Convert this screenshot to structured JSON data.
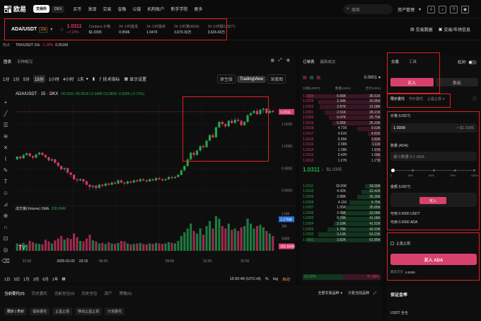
{
  "nav": {
    "logo": "欧易",
    "pill_exchange": "交易所",
    "pill_dex": "DEX",
    "items": [
      "买币",
      "发现",
      "交易",
      "金融",
      "公链",
      "机构账户",
      "新手学院",
      "更多"
    ],
    "search_placeholder": "搜索",
    "asset_mgmt": "资产管理"
  },
  "ticker": {
    "pair": "ADA/USDT",
    "leverage": "10x",
    "price": "1.0311",
    "change": "+7.24%",
    "stats": [
      {
        "label": "Cardano 价格",
        "value": "$1.0305"
      },
      {
        "label": "24 小时最低",
        "value": "0.9596"
      },
      {
        "label": "24 小时最高",
        "value": "1.0470"
      },
      {
        "label": "24 小时量(ADA)",
        "value": "3,670.33万"
      },
      {
        "label": "24 小时额(USDT)",
        "value": "3,626.43万"
      }
    ],
    "right_links": [
      "交易数据",
      "交易/市场信息"
    ]
  },
  "subticker": {
    "label": "热点",
    "pair": "TRX/USDT 10x",
    "change": "-1.28%",
    "price": "0.26160"
  },
  "chart": {
    "tabs": [
      "图表",
      "币种概况"
    ],
    "intervals": [
      "1分",
      "1分",
      "5分",
      "15分",
      "1小时",
      "4小时",
      "1天"
    ],
    "active_interval": "15分",
    "indicator_label": "技术指标",
    "display_label": "显示设置",
    "modes": [
      "原生版",
      "TradingView",
      "深度图"
    ],
    "active_mode": "TradingView",
    "legend_pair": "ADA/USDT · 15 · OKX",
    "legend_values": "O0.9911 H0.9818 L0.9408 C0.9838 -0.0059 (-0.72%)",
    "price_tag": "1.0311",
    "price_levels": [
      "1.0200",
      "1.0000",
      "0.9800",
      "0.9600"
    ],
    "volume_label": "成交量(Volume) SMA",
    "volume_value": "228.654K",
    "volume_levels": [
      "1.5M",
      "1M",
      "500K"
    ],
    "volume_tag": "1.276M",
    "volume_tag2": "181.654K",
    "time_labels": [
      "21:00",
      "2025-01-02",
      "23:15",
      "06:00",
      "09:00",
      "12:00",
      "15:00"
    ],
    "ranges": [
      "1日",
      "5日",
      "1月",
      "3月",
      "6月",
      "1年"
    ],
    "footer_time": "15:50:49 (UTC+8)",
    "footer_pct": "%",
    "footer_log": "log",
    "footer_auto": "自动"
  },
  "chart_data": {
    "type": "candlestick",
    "candles": [
      [
        0.988,
        0.9905,
        0.987,
        0.991
      ],
      [
        0.9905,
        0.989,
        0.988,
        0.9915
      ],
      [
        0.989,
        0.992,
        0.9885,
        0.993
      ],
      [
        0.992,
        0.9935,
        0.991,
        0.9945
      ],
      [
        0.9935,
        0.991,
        0.99,
        0.994
      ],
      [
        0.991,
        0.9895,
        0.988,
        0.9915
      ],
      [
        0.9895,
        0.9925,
        0.989,
        0.993
      ],
      [
        0.9925,
        0.994,
        0.9915,
        0.995
      ],
      [
        0.994,
        0.992,
        0.991,
        0.9945
      ],
      [
        0.992,
        0.99,
        0.989,
        0.9925
      ],
      [
        0.99,
        0.987,
        0.986,
        0.9905
      ],
      [
        0.987,
        0.988,
        0.986,
        0.989
      ],
      [
        0.988,
        0.985,
        0.984,
        0.9885
      ],
      [
        0.985,
        0.982,
        0.981,
        0.9855
      ],
      [
        0.982,
        0.979,
        0.978,
        0.9825
      ],
      [
        0.979,
        0.98,
        0.977,
        0.981
      ],
      [
        0.98,
        0.976,
        0.975,
        0.9805
      ],
      [
        0.976,
        0.974,
        0.972,
        0.9765
      ],
      [
        0.974,
        0.97,
        0.969,
        0.9745
      ],
      [
        0.97,
        0.969,
        0.967,
        0.971
      ],
      [
        0.969,
        0.97,
        0.968,
        0.971
      ],
      [
        0.97,
        0.968,
        0.966,
        0.9705
      ],
      [
        0.968,
        0.965,
        0.964,
        0.969
      ],
      [
        0.965,
        0.963,
        0.96,
        0.9655
      ],
      [
        0.963,
        0.964,
        0.961,
        0.965
      ],
      [
        0.964,
        0.962,
        0.96,
        0.965
      ],
      [
        0.962,
        0.965,
        0.961,
        0.966
      ],
      [
        0.965,
        0.964,
        0.9625,
        0.966
      ],
      [
        0.964,
        0.966,
        0.963,
        0.967
      ],
      [
        0.966,
        0.965,
        0.964,
        0.967
      ],
      [
        0.965,
        0.967,
        0.9645,
        0.968
      ],
      [
        0.967,
        0.966,
        0.965,
        0.968
      ],
      [
        0.966,
        0.969,
        0.9655,
        0.97
      ],
      [
        0.969,
        0.967,
        0.966,
        0.97
      ],
      [
        0.967,
        0.966,
        0.964,
        0.9675
      ],
      [
        0.966,
        0.968,
        0.965,
        0.969
      ],
      [
        0.968,
        0.967,
        0.966,
        0.969
      ],
      [
        0.967,
        0.969,
        0.9665,
        0.97
      ],
      [
        0.969,
        0.968,
        0.967,
        0.97
      ],
      [
        0.968,
        0.97,
        0.9675,
        0.971
      ],
      [
        0.97,
        0.969,
        0.968,
        0.971
      ],
      [
        0.969,
        0.968,
        0.967,
        0.97
      ],
      [
        0.968,
        0.97,
        0.9675,
        0.971
      ],
      [
        0.97,
        0.969,
        0.968,
        0.971
      ],
      [
        0.969,
        0.971,
        0.9685,
        0.972
      ],
      [
        0.971,
        0.97,
        0.969,
        0.972
      ],
      [
        0.97,
        0.969,
        0.968,
        0.971
      ],
      [
        0.969,
        0.97,
        0.9685,
        0.971
      ],
      [
        0.97,
        0.972,
        0.9695,
        0.973
      ],
      [
        0.972,
        0.971,
        0.97,
        0.973
      ],
      [
        0.971,
        0.972,
        0.9705,
        0.973
      ],
      [
        0.972,
        0.974,
        0.9715,
        0.975
      ],
      [
        0.974,
        0.978,
        0.9735,
        0.979
      ],
      [
        0.978,
        0.982,
        0.977,
        0.983
      ],
      [
        0.982,
        0.988,
        0.981,
        0.989
      ],
      [
        0.988,
        0.994,
        0.987,
        0.995
      ],
      [
        0.994,
        0.992,
        0.99,
        0.996
      ],
      [
        0.992,
        0.996,
        0.991,
        0.997
      ],
      [
        0.996,
        1.0,
        0.995,
        1.001
      ],
      [
        1.0,
        0.999,
        0.998,
        1.002
      ],
      [
        0.999,
        1.005,
        0.9985,
        1.006
      ],
      [
        1.005,
        1.01,
        1.004,
        1.011
      ],
      [
        1.01,
        1.008,
        1.007,
        1.012
      ],
      [
        1.008,
        1.017,
        1.0075,
        1.018
      ],
      [
        1.017,
        1.022,
        1.016,
        1.023
      ],
      [
        1.022,
        1.02,
        1.018,
        1.023
      ],
      [
        1.02,
        1.018,
        1.016,
        1.021
      ],
      [
        1.018,
        1.023,
        1.017,
        1.024
      ],
      [
        1.023,
        1.021,
        1.02,
        1.025
      ],
      [
        1.021,
        1.024,
        1.02,
        1.026
      ],
      [
        1.024,
        1.023,
        1.0215,
        1.026
      ],
      [
        1.023,
        1.019,
        1.018,
        1.024
      ],
      [
        1.019,
        1.022,
        1.0185,
        1.023
      ],
      [
        1.022,
        1.028,
        1.021,
        1.029
      ],
      [
        1.028,
        1.03,
        1.027,
        1.031
      ],
      [
        1.03,
        1.032,
        1.029,
        1.033
      ],
      [
        1.032,
        1.029,
        1.028,
        1.034
      ],
      [
        1.029,
        1.033,
        1.0285,
        1.034
      ],
      [
        1.033,
        1.034,
        1.03,
        1.035
      ],
      [
        1.034,
        1.03,
        1.029,
        1.0345
      ],
      [
        1.03,
        1.032,
        1.0295,
        1.034
      ],
      [
        1.032,
        1.0311,
        1.03,
        1.033
      ]
    ],
    "volumes": [
      300,
      280,
      320,
      250,
      400,
      350,
      300,
      280,
      260,
      450,
      380,
      300,
      420,
      500,
      600,
      450,
      520,
      480,
      700,
      550,
      400,
      380,
      500,
      650,
      420,
      380,
      300,
      320,
      280,
      350,
      300,
      280,
      320,
      400,
      380,
      300,
      260,
      280,
      300,
      320,
      280,
      260,
      300,
      280,
      320,
      300,
      280,
      300,
      350,
      320,
      300,
      400,
      600,
      750,
      900,
      1100,
      800,
      700,
      900,
      650,
      1000,
      1200,
      900,
      1400,
      1300,
      1000,
      900,
      1100,
      850,
      900,
      800,
      950,
      1000,
      1300,
      1100,
      900,
      1000,
      1050,
      950,
      800,
      700,
      600
    ],
    "ylim": [
      0.95,
      1.04
    ],
    "volume_ylim": [
      0,
      1600
    ]
  },
  "orderbook": {
    "tabs": [
      "订单表",
      "最新成交"
    ],
    "precision": "0.0001",
    "col_price": "价格(USDT)",
    "col_qty": "数量(ADA)",
    "col_total": "合计(ADA)",
    "asks": [
      [
        "1.0324",
        "5.66K",
        "36.51K",
        0.95
      ],
      [
        "1.0323",
        "2.34K",
        "30.85K",
        0.8
      ],
      [
        "1.0322",
        "2.87K",
        "31.08K",
        0.78
      ],
      [
        "1.0321",
        "2.51K",
        "28.21K",
        0.72
      ],
      [
        "1.0320",
        "0.47K",
        "25.70K",
        0.66
      ],
      [
        "1.0319",
        "5.55K",
        "25.23K",
        0.62
      ],
      [
        "1.0318",
        "4.71K",
        "9.53K",
        0.3
      ],
      [
        "1.0317",
        "4.61K",
        "4.82K",
        0.16
      ],
      [
        "1.0316",
        "0.05K",
        "3.82K",
        0.12
      ],
      [
        "1.0315",
        "2.58K",
        "3.11K",
        0.1
      ],
      [
        "1.0314",
        "1.28K",
        "1.97K",
        0.07
      ],
      [
        "1.0313",
        "0.42K",
        "1.69K",
        0.06
      ],
      [
        "1.0312",
        "1.27K",
        "1.27K",
        0.04
      ]
    ],
    "mid_price": "1.0311",
    "mid_arrow": "↓",
    "mid_usd": "$1.0305",
    "bids": [
      [
        "1.0311",
        "18.00K",
        "18.00K",
        0.2
      ],
      [
        "1.0310",
        "4.42K",
        "22.42K",
        0.25
      ],
      [
        "1.0309",
        "3.88K",
        "26.30K",
        0.3
      ],
      [
        "1.0308",
        "4.11K",
        "9.75K",
        0.4
      ],
      [
        "1.0307",
        "1.55K",
        "35.85K",
        0.45
      ],
      [
        "1.0306",
        "3.45K",
        "33.08K",
        0.5
      ],
      [
        "1.0305",
        "0.78K",
        "41.08K",
        0.55
      ],
      [
        "1.0304",
        "2.18K",
        "41.52K",
        0.6
      ],
      [
        "1.0303",
        "1.78K",
        "43.23K",
        0.68
      ],
      [
        "1.0302",
        "3.13K",
        "53.23K",
        0.8
      ],
      [
        "1.0301",
        "3.82K",
        "61.85K",
        0.95
      ]
    ],
    "buy_pct": "52.02%",
    "sell_pct": "47.98%",
    "buy_ratio": 0.52
  },
  "tradepanel": {
    "tabs": [
      "交易",
      "工具"
    ],
    "leverage_label": "杠杆",
    "buy_label": "买入",
    "sell_label": "卖出",
    "order_types": [
      "限价委托",
      "市价委托",
      "止盈止损"
    ],
    "price_label": "价格 (USDT)",
    "price_value": "1.0309",
    "price_usd": "≈ $1.0305",
    "qty_label": "数量 (ADA)",
    "qty_placeholder": "最小数量 0.1 ADA",
    "total_label": "金额 (USDT)",
    "available_usdt": "可用 0.0000 USDT",
    "available_ada": "可用 0.0000 ADA",
    "tpsl_label": "止盈止损",
    "submit_label": "买入 ADA",
    "fee_label": "最高可买",
    "fee_value": "0.0000",
    "slider_ticks": [
      "0",
      "25%",
      "50%",
      "75%",
      "100%"
    ]
  },
  "bottom": {
    "tabs": [
      "当前委托(0)",
      "历史委托",
      "当前仓位(0)",
      "历史仓位",
      "资产",
      "策略(0)"
    ],
    "right_select": "全部交易品种",
    "right_filter": "只看当前品种",
    "sub_buttons": [
      "限价 | 市价",
      "指标委托",
      "止盈止损",
      "移动止盈止损",
      "计划委托"
    ],
    "protect_title": "保证金率",
    "protect_sub": "USDT 全仓"
  },
  "colors": {
    "green": "#25a750",
    "red": "#e2366b",
    "accent": "#d9416d"
  }
}
